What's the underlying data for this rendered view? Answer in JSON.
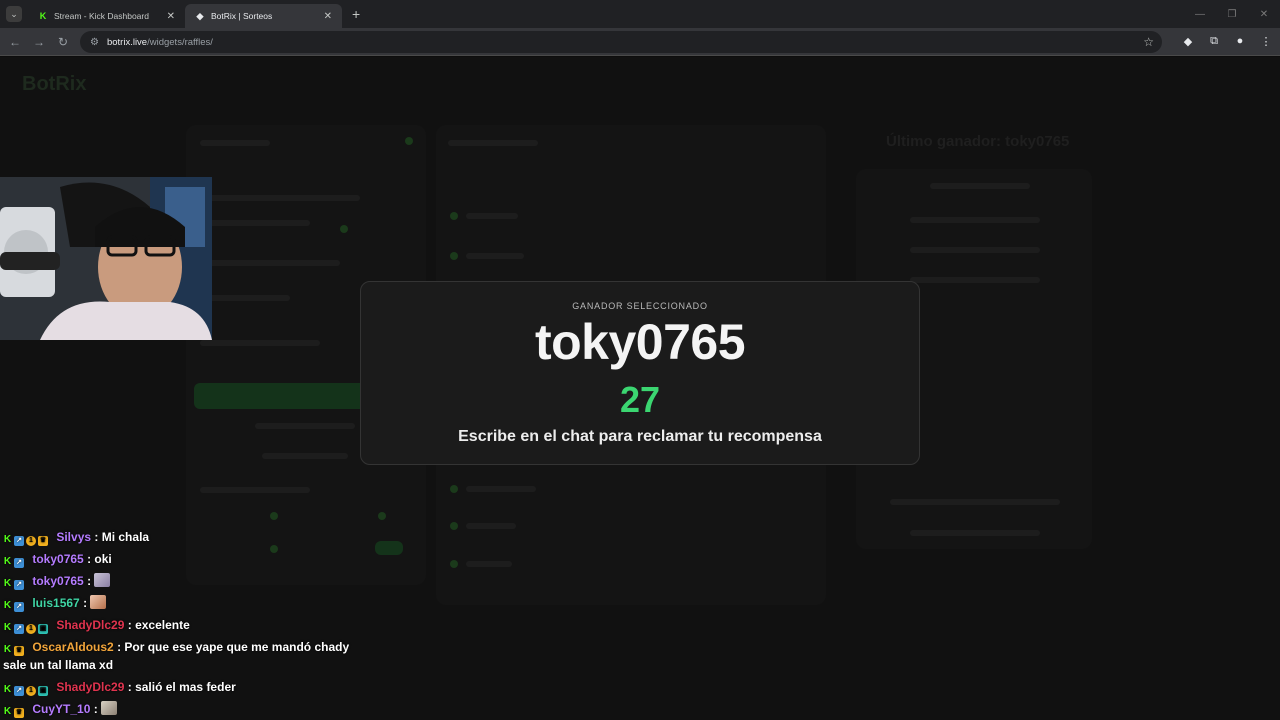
{
  "browser": {
    "tabs": [
      {
        "title": "Stream - Kick Dashboard",
        "active": false,
        "favicon": "kick-icon"
      },
      {
        "title": "BotRix | Sorteos",
        "active": true,
        "favicon": "botrix-icon"
      }
    ],
    "url_host": "botrix.live",
    "url_path": "/widgets/raffles/"
  },
  "background": {
    "logo": "BotRix",
    "panel_title": "Último ganador: toky0765"
  },
  "modal": {
    "label": "GANADOR SELECCIONADO",
    "winner": "toky0765",
    "timer": "27",
    "message": "Escribe en el chat para reclamar tu recompensa"
  },
  "colors": {
    "accent": "#3bd671",
    "kick_green": "#53fc18"
  },
  "chat": [
    {
      "user": "Silvys",
      "color": "#b57cff",
      "badges": [
        "kick",
        "og",
        "gift",
        "sub"
      ],
      "text": ": Mi chala"
    },
    {
      "user": "toky0765",
      "color": "#b57cff",
      "badges": [
        "kick",
        "og"
      ],
      "text": ": oki"
    },
    {
      "user": "toky0765",
      "color": "#b57cff",
      "badges": [
        "kick",
        "og"
      ],
      "text": ":",
      "emote": true
    },
    {
      "user": "luis1567",
      "color": "#3fd4a4",
      "badges": [
        "kick",
        "og"
      ],
      "text": ":",
      "emote": true
    },
    {
      "user": "ShadyDlc29",
      "color": "#e0344f",
      "badges": [
        "kick",
        "og",
        "gift",
        "sub2"
      ],
      "text": ": excelente"
    },
    {
      "user": "OscarAldous2",
      "color": "#f2a53b",
      "badges": [
        "kick",
        "sub"
      ],
      "text": ": Por que ese yape que me mandó chady sale un tal llama xd"
    },
    {
      "user": "ShadyDlc29",
      "color": "#e0344f",
      "badges": [
        "kick",
        "og",
        "gift",
        "sub2"
      ],
      "text": ": salió el mas feder"
    },
    {
      "user": "CuyYT_10",
      "color": "#b57cff",
      "badges": [
        "kick",
        "sub"
      ],
      "text": ":",
      "emote": true
    }
  ]
}
